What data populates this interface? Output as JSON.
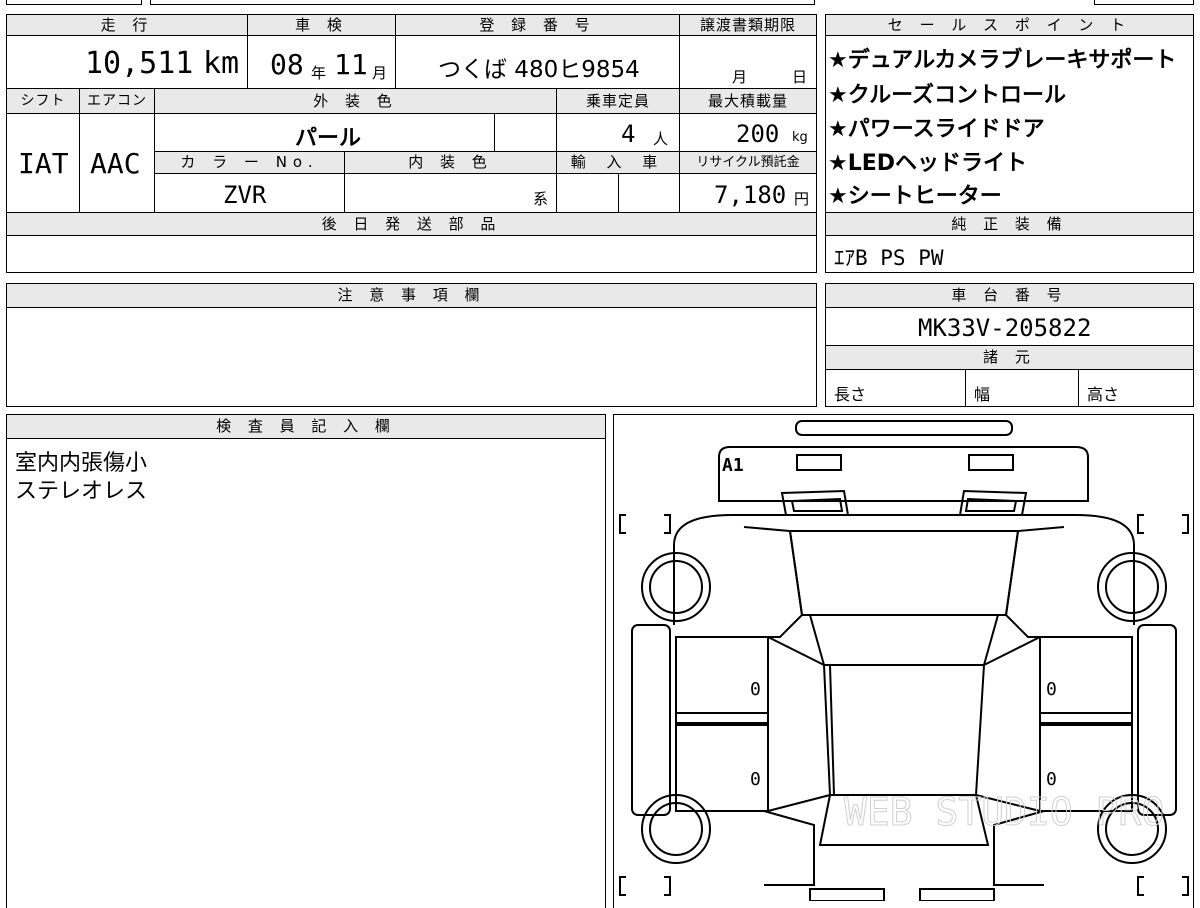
{
  "top": {
    "mileage_label": "走 行",
    "mileage_value": "10,511",
    "mileage_unit": "km",
    "shaken_label": "車 検",
    "shaken_year": "08",
    "shaken_year_unit": "年",
    "shaken_month": "11",
    "shaken_month_unit": "月",
    "registration_label": "登 録 番 号",
    "registration_value": "つくば 480ヒ9854",
    "transfer_label": "譲渡書類期限",
    "transfer_month": "月",
    "transfer_day": "日"
  },
  "row2": {
    "shift_label": "シフト",
    "shift_value": "IAT",
    "aircon_label": "エアコン",
    "aircon_value": "AAC",
    "exterior_label": "外 装 色",
    "exterior_value": "パール",
    "capacity_label": "乗車定員",
    "capacity_value": "4",
    "capacity_unit": "人",
    "load_label": "最大積載量",
    "load_value": "200",
    "load_unit": "kg",
    "color_no_label": "カ ラ ー No.",
    "color_no_value": "ZVR",
    "interior_label": "内 装 色",
    "interior_suffix": "系",
    "import_label": "輸 入 車",
    "recycle_label": "リサイクル預託金",
    "recycle_value": "7,180",
    "recycle_unit": "円"
  },
  "later_parts": {
    "label": "後 日 発 送 部 品",
    "value": ""
  },
  "sales_points": {
    "label": "セ ー ル ス ポ イ ン ト",
    "items": [
      "★デュアルカメラブレーキサポート",
      "★クルーズコントロール",
      "★パワースライドドア",
      "★LEDヘッドライト",
      "★シートヒーター"
    ]
  },
  "genuine_equipment": {
    "label": "純 正 装 備",
    "value": "ｴｱB PS PW"
  },
  "notes": {
    "label": "注 意 事 項 欄",
    "value": ""
  },
  "chassis": {
    "label": "車 台 番 号",
    "value": "MK33V-205822"
  },
  "specs": {
    "label": "諸 元",
    "length_label": "長さ",
    "width_label": "幅",
    "height_label": "高さ"
  },
  "inspector": {
    "label": "検 査 員 記 入 欄",
    "lines": [
      "室内内張傷小",
      "ステレオレス"
    ]
  },
  "diagram": {
    "mark_a1": "A1",
    "left_mark_1": "0",
    "left_mark_2": "0",
    "right_mark_1": "0",
    "right_mark_2": "0",
    "watermark": "WEB STUDIO PRO"
  }
}
